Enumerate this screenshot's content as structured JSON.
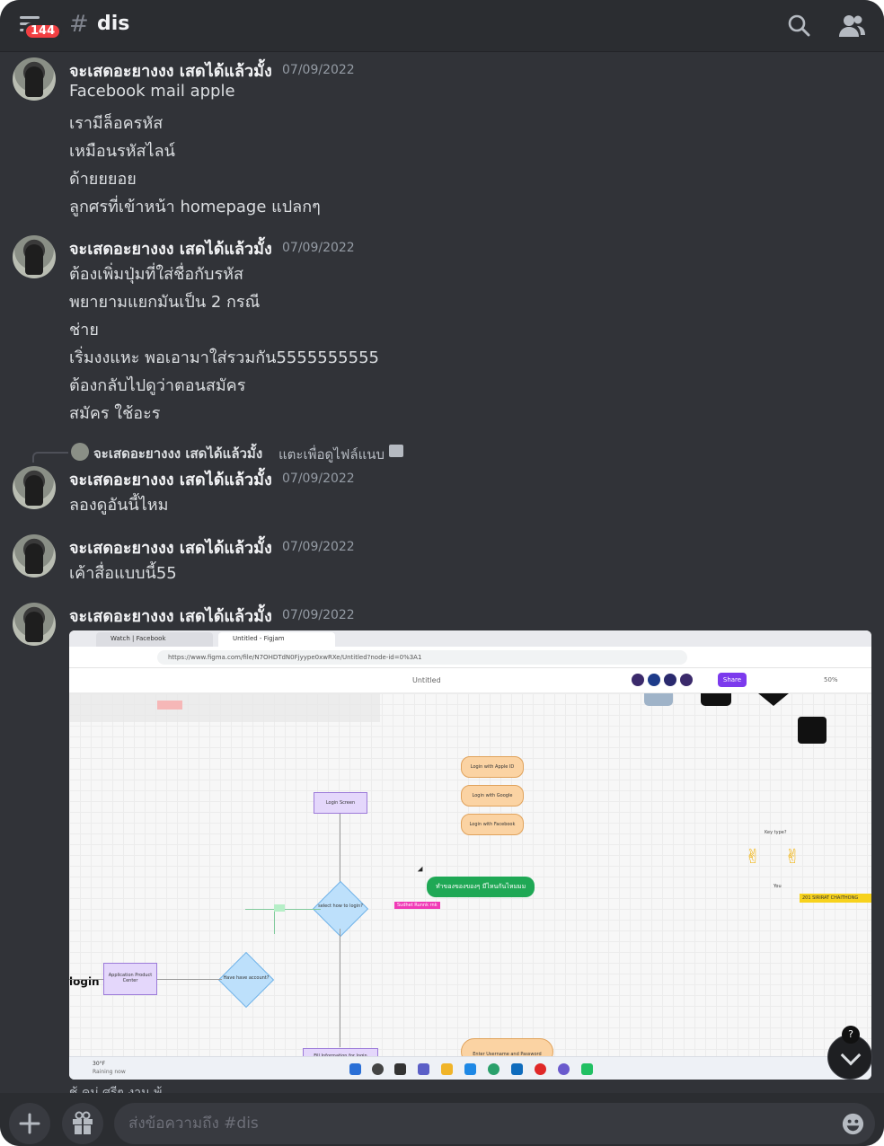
{
  "header": {
    "unread_count": "144",
    "channel_hash": "#",
    "channel_name": "dis"
  },
  "messages": [
    {
      "author": "จะเสดอะยางงง เสดได้แล้วมั้ง",
      "timestamp": "07/09/2022",
      "lines": [
        "Facebook mail apple",
        "เรามีล็อครหัส",
        "เหมือนรหัสไลน์",
        "ด้ายยยอย",
        "ลูกศรที่เข้าหน้า homepage แปลกๆ"
      ]
    },
    {
      "author": "จะเสดอะยางงง เสดได้แล้วมั้ง",
      "timestamp": "07/09/2022",
      "lines": [
        "ต้องเพิ่มปุ่มที่ใส่ชื่อกับรหัส",
        "พยายามแยกมันเป็น 2 กรณี",
        "ช่าย",
        "เริ่มงงแหะ พอเอามาใส่รวมกัน5555555555",
        "ต้องกลับไปดูว่าตอนสมัคร",
        "สมัคร ใช้อะร"
      ]
    },
    {
      "author": "จะเสดอะยางงง เสดได้แล้วมั้ง",
      "timestamp": "07/09/2022",
      "reply": {
        "author": "จะเสดอะยางงง เสดได้แล้วมั้ง",
        "text": "แตะเพื่อดูไฟล์แนบ"
      },
      "lines": [
        "ลองดูอันนี้ไหม"
      ]
    },
    {
      "author": "จะเสดอะยางงง เสดได้แล้วมั้ง",
      "timestamp": "07/09/2022",
      "lines": [
        "เค้าสื่อแบบนี้55"
      ]
    },
    {
      "author": "จะเสดอะยางงง เสดได้แล้วมั้ง",
      "timestamp": "07/09/2022",
      "lines": []
    }
  ],
  "attachment": {
    "browser_tabs": [
      "Watch | Facebook",
      "Untitled - Figjam"
    ],
    "url": "https://www.figma.com/file/N7OHDTdN0Fjyype0xwRXe/Untitled?node-id=0%3A1",
    "figma_title": "Untitled",
    "share_label": "Share",
    "zoom": "50%",
    "nodes": {
      "login_screen": "Login Screen",
      "login_apple": "Login with Apple ID",
      "login_google": "Login with Google",
      "login_facebook": "Login with Facebook",
      "select_login": "select how to login?",
      "have_account": "Have have account?",
      "app_product": "Application Product Center",
      "fill_info": "Fill Information for login",
      "enter_user": "Enter Username and Password",
      "green_note": "ทำของของของๆ มีไหนกันไหมมม",
      "pink_cursor": "Sudhet Runnk rnk",
      "yellow_cursor": "201 SIRIRAT CHAITHONG",
      "key_label": "Key type?",
      "login_heading": "login",
      "you_label": "You"
    },
    "taskbar": {
      "weather_temp": "30°F",
      "weather_desc": "Raining now",
      "help_badge": "?"
    }
  },
  "footer": {
    "peek_text": "ช้ คม่ ศรีๆ งาน พ้",
    "composer_placeholder": "ส่งข้อความถึง #dis"
  },
  "colors": {
    "background": "#313338",
    "header": "#2b2d31",
    "badge": "#f23f42",
    "timestamp": "#949ba4"
  },
  "icons": [
    "hamburger-icon",
    "search-icon",
    "members-icon",
    "plus-icon",
    "gift-icon",
    "emoji-icon",
    "chevron-down-icon"
  ]
}
